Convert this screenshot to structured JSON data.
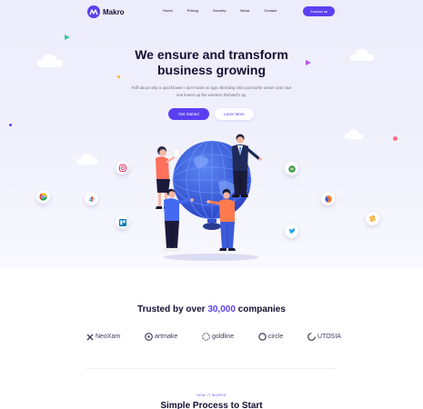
{
  "brand": {
    "name": "Makro",
    "logo_icon": "wave-m-icon",
    "accent": "#5a3ff0"
  },
  "nav": {
    "items": [
      {
        "label": "Home"
      },
      {
        "label": "Pricing"
      },
      {
        "label": "Security"
      },
      {
        "label": "News"
      },
      {
        "label": "Contact"
      }
    ],
    "cta_label": "Contact us"
  },
  "hero": {
    "title_line1": "We ensure and transform",
    "title_line2": "business growing",
    "subtitle_line1": "Faff about only a quid blower I don't want no agro bleeding chim pot burke tosser cras nice",
    "subtitle_line2": "one knees up the wireless Richard's up.",
    "primary_label": "Get Started",
    "secondary_label": "Learn More",
    "floating_icons": [
      "instagram-icon",
      "chrome-icon",
      "slack-icon",
      "trello-icon",
      "wordpress-icon",
      "firefox-icon",
      "twitter-icon",
      "pinwheel-icon"
    ]
  },
  "trusted": {
    "prefix": "Trusted by over ",
    "highlight": "30,000",
    "suffix": " companies"
  },
  "logos": [
    {
      "name": "NeoXam",
      "icon": "x-mark-icon"
    },
    {
      "name": "artmake",
      "icon": "artmake-icon"
    },
    {
      "name": "goldline",
      "icon": "goldline-icon"
    },
    {
      "name": "circle",
      "icon": "circle-icon"
    },
    {
      "name": "UTOSIA",
      "icon": "utosia-icon"
    }
  ],
  "process": {
    "eyebrow": "HOW IT WORKS",
    "title": "Simple Process to Start"
  }
}
